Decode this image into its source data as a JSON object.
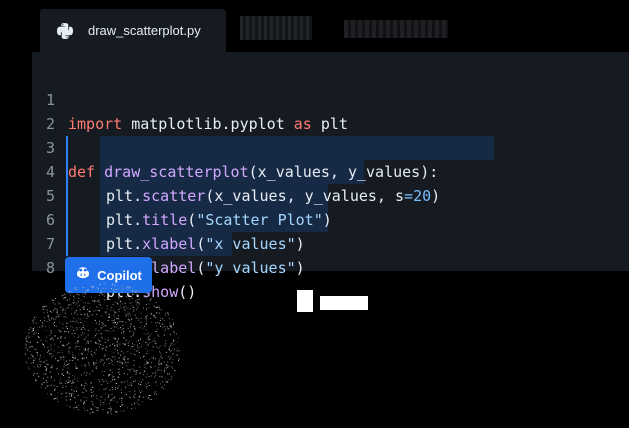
{
  "tabs": {
    "active": {
      "label": "draw_scatterplot.py",
      "icon": "python-icon"
    }
  },
  "editor": {
    "lines": [
      {
        "number": "1",
        "text": "import matplotlib.pyplot as plt"
      },
      {
        "number": "2",
        "text": ""
      },
      {
        "number": "3",
        "text": "def draw_scatterplot(x_values, y_values):"
      },
      {
        "number": "4",
        "text": "plt.scatter(x_values, y_values, s=20)"
      },
      {
        "number": "5",
        "text": "plt.title(\"Scatter Plot\")"
      },
      {
        "number": "6",
        "text": "plt.xlabel(\"x values\")"
      },
      {
        "number": "7",
        "text": "plt.ylabel(\"y values\")"
      },
      {
        "number": "8",
        "text": "plt.show()"
      }
    ]
  },
  "copilot": {
    "label": "Copilot",
    "icon": "copilot-icon"
  },
  "colors": {
    "editor_bg": "#161b22",
    "selection": "#172a45",
    "accent": "#1f6feb",
    "keyword": "#ff7b72",
    "function": "#d2a8ff",
    "string": "#a5d6ff",
    "number": "#79c0ff"
  }
}
